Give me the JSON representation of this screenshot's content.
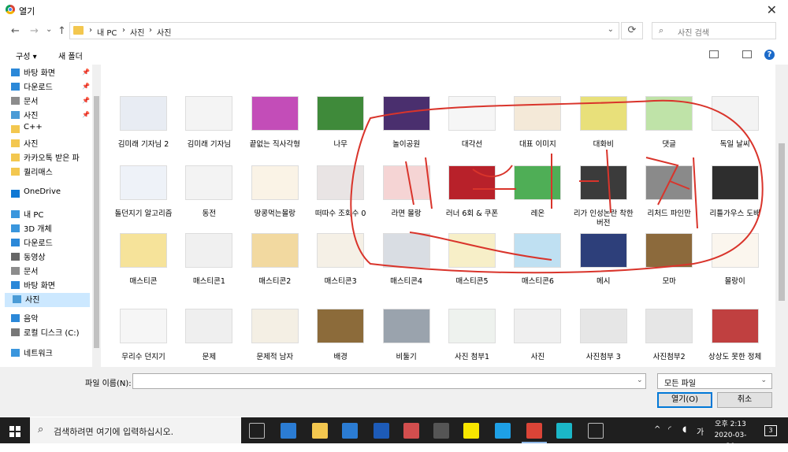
{
  "window": {
    "title": "열기",
    "close_glyph": "✕"
  },
  "nav": {
    "back": "←",
    "forward": "→",
    "recent": "⌄",
    "up": "↑"
  },
  "address": {
    "crumbs": [
      "›",
      "내 PC",
      "›",
      "사진",
      "›",
      "사진"
    ],
    "refresh": "⟳"
  },
  "search": {
    "placeholder": "사진 검색",
    "icon": "⌕"
  },
  "commands": {
    "organize": "구성 ▾",
    "new_folder": "새 폴더",
    "help": "?"
  },
  "sidebar": {
    "items": [
      {
        "label": "바탕 화면",
        "icon": "desktop-icon",
        "color": "#2b88d8",
        "pinned": true
      },
      {
        "label": "다운로드",
        "icon": "download-icon",
        "color": "#2b88d8",
        "pinned": true
      },
      {
        "label": "문서",
        "icon": "document-icon",
        "color": "#8c8c8c",
        "pinned": true
      },
      {
        "label": "사진",
        "icon": "pictures-icon",
        "color": "#4a9bd6",
        "pinned": true
      },
      {
        "label": "C++",
        "icon": "folder-icon",
        "color": "#f3c74f",
        "pinned": false
      },
      {
        "label": "사진",
        "icon": "folder-icon",
        "color": "#f3c74f",
        "pinned": false
      },
      {
        "label": "카카오톡 받은 파",
        "icon": "folder-icon",
        "color": "#f3c74f",
        "pinned": false
      },
      {
        "label": "퀄리매스",
        "icon": "folder-icon",
        "color": "#f3c74f",
        "pinned": false
      },
      {
        "label": "OneDrive",
        "icon": "cloud-icon",
        "color": "#0f78d4",
        "pinned": false
      },
      {
        "label": "내 PC",
        "icon": "pc-icon",
        "color": "#3a96dd",
        "pinned": false
      },
      {
        "label": "3D 개체",
        "icon": "cube-icon",
        "color": "#3a96dd",
        "pinned": false
      },
      {
        "label": "다운로드",
        "icon": "download-icon",
        "color": "#2b88d8",
        "pinned": false
      },
      {
        "label": "동영상",
        "icon": "video-icon",
        "color": "#666666",
        "pinned": false
      },
      {
        "label": "문서",
        "icon": "document-icon",
        "color": "#8c8c8c",
        "pinned": false
      },
      {
        "label": "바탕 화면",
        "icon": "desktop-icon",
        "color": "#2b88d8",
        "pinned": false
      },
      {
        "label": "사진",
        "icon": "pictures-icon",
        "color": "#4a9bd6",
        "pinned": false,
        "selected": true
      },
      {
        "label": "음악",
        "icon": "music-icon",
        "color": "#2b88d8",
        "pinned": false
      },
      {
        "label": "로컬 디스크 (C:)",
        "icon": "disk-icon",
        "color": "#777777",
        "pinned": false
      },
      {
        "label": "네트워크",
        "icon": "network-icon",
        "color": "#3a96dd",
        "pinned": false
      }
    ]
  },
  "files": [
    {
      "name": "김미래 기자님 2",
      "color": "#e8ecf3"
    },
    {
      "name": "김미래 기자님",
      "color": "#f4f4f4"
    },
    {
      "name": "끝없는 직사각형",
      "color": "#c34db8"
    },
    {
      "name": "나무",
      "color": "#3f8a3a"
    },
    {
      "name": "놀이공원",
      "color": "#4a2f6e"
    },
    {
      "name": "대각선",
      "color": "#f6f6f6"
    },
    {
      "name": "대표 이미지",
      "color": "#f4e9d8"
    },
    {
      "name": "대화비",
      "color": "#e8e07a"
    },
    {
      "name": "댓글",
      "color": "#bfe3a8"
    },
    {
      "name": "독일 날씨",
      "color": "#f3f3f3"
    },
    {
      "name": "돌던지기 알고리즘",
      "color": "#eef2f8"
    },
    {
      "name": "동전",
      "color": "#f3f3f3"
    },
    {
      "name": "땅콩먹는몰랑",
      "color": "#faf3e6"
    },
    {
      "name": "떠따수 조회수 0",
      "color": "#e9e4e4"
    },
    {
      "name": "라면 몰랑",
      "color": "#f5d4d4"
    },
    {
      "name": "러너 6회 & 쿠폰",
      "color": "#b8212a"
    },
    {
      "name": "레온",
      "color": "#4fae56"
    },
    {
      "name": "리가 인성논란 착한 버전",
      "color": "#3b3b3b"
    },
    {
      "name": "리처드 파인만",
      "color": "#8a8a8a"
    },
    {
      "name": "리틀가우스 도배",
      "color": "#2e2e2e"
    },
    {
      "name": "매스티콘",
      "color": "#f6e39a"
    },
    {
      "name": "매스티콘1",
      "color": "#f0f0f0"
    },
    {
      "name": "매스티콘2",
      "color": "#f2d9a0"
    },
    {
      "name": "매스티콘3",
      "color": "#f5f0e6"
    },
    {
      "name": "매스티콘4",
      "color": "#d9dde3"
    },
    {
      "name": "매스티콘5",
      "color": "#f7efc8"
    },
    {
      "name": "매스티콘6",
      "color": "#bfe0f2"
    },
    {
      "name": "메시",
      "color": "#2d3f7a"
    },
    {
      "name": "모마",
      "color": "#8c6a3c"
    },
    {
      "name": "몰랑이",
      "color": "#fbf6ee"
    },
    {
      "name": "무리수 던지기",
      "color": "#f6f6f6"
    },
    {
      "name": "문제",
      "color": "#efefef"
    },
    {
      "name": "문제적 남자",
      "color": "#f4efe4"
    },
    {
      "name": "배경",
      "color": "#8c6b3a"
    },
    {
      "name": "비둘기",
      "color": "#9aa3ad"
    },
    {
      "name": "사진 첨부1",
      "color": "#eef2ee"
    },
    {
      "name": "사진",
      "color": "#efefef"
    },
    {
      "name": "사진첨부 3",
      "color": "#e6e6e6"
    },
    {
      "name": "사진첨부2",
      "color": "#e6e6e6"
    },
    {
      "name": "상상도 못한 정체",
      "color": "#c04040"
    }
  ],
  "bottom": {
    "filename_label": "파일 이름(N):",
    "filename_value": "",
    "filetype": "모든 파일",
    "open": "열기(O)",
    "cancel": "취소",
    "dropdown_glyph": "⌄"
  },
  "taskbar": {
    "search_text": "검색하려면 여기에 입력하십시오.",
    "time": "오후 2:13",
    "date": "2020-03-20",
    "ime": "가",
    "notifications": "3",
    "apps": [
      {
        "name": "task-view-icon",
        "color": "#1f1f1f"
      },
      {
        "name": "mail-icon",
        "color": "#2b7cd3"
      },
      {
        "name": "file-explorer-icon",
        "color": "#f3c74f"
      },
      {
        "name": "store-icon",
        "color": "#2b7cd3"
      },
      {
        "name": "dev-cpp-icon",
        "color": "#1d5bb8"
      },
      {
        "name": "paint-icon",
        "color": "#d24e4e"
      },
      {
        "name": "calculator-icon",
        "color": "#555555"
      },
      {
        "name": "kakaotalk-icon",
        "color": "#f7e600"
      },
      {
        "name": "internet-explorer-icon",
        "color": "#1ea0e6"
      },
      {
        "name": "chrome-icon",
        "color": "#db4437"
      },
      {
        "name": "app-icon",
        "color": "#1bb7c8"
      },
      {
        "name": "settings-icon",
        "color": "#1f1f1f"
      }
    ]
  }
}
